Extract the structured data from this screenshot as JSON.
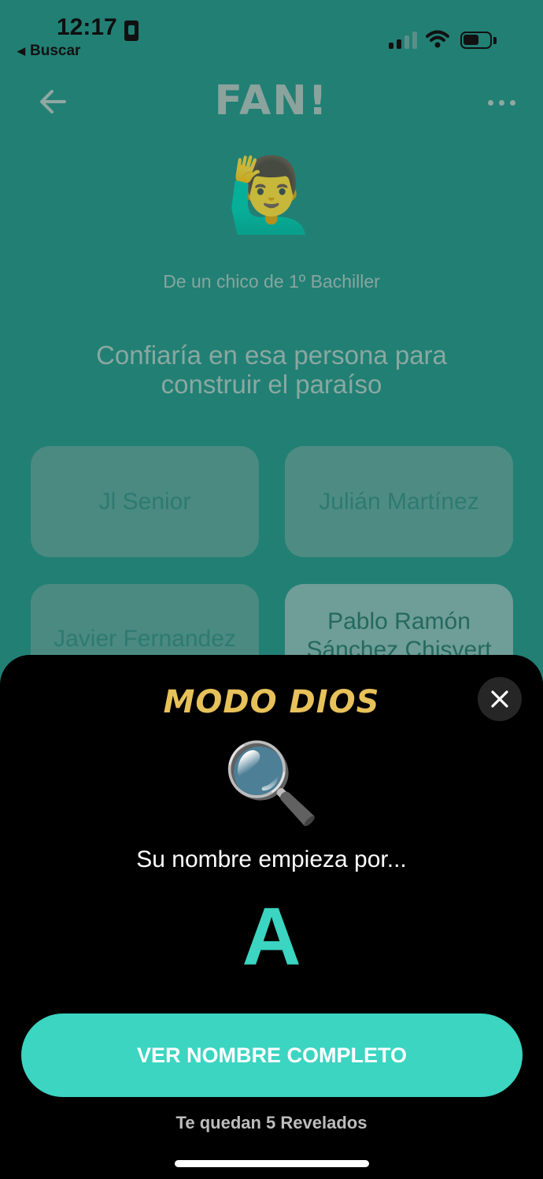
{
  "status_bar": {
    "time": "12:17",
    "back_app_label": "Buscar",
    "battery_level": 0.6
  },
  "header": {
    "logo_text": "FAN!",
    "back_icon": "arrow-left-icon",
    "more_icon": "ellipsis-icon"
  },
  "poll": {
    "emoji": "🙋‍♂️",
    "sender": "De un chico de 1º Bachiller",
    "question": "Confiaría en esa persona para construir el paraíso",
    "options": [
      {
        "label": "Jl Senior"
      },
      {
        "label": "Julián Martínez"
      },
      {
        "label": "Javier Fernandez"
      },
      {
        "label": "Pablo Ramón Sánchez Chisvert"
      }
    ]
  },
  "god_mode_sheet": {
    "title": "MODO DIOS",
    "icon": "🔍",
    "hint": "Su nombre empieza por...",
    "initial": "A",
    "cta_label": "VER NOMBRE COMPLETO",
    "remaining_text": "Te quedan 5 Revelados"
  },
  "colors": {
    "background": "#227F74",
    "accent": "#3BD5C1",
    "title_gold": "#E7C15A"
  }
}
